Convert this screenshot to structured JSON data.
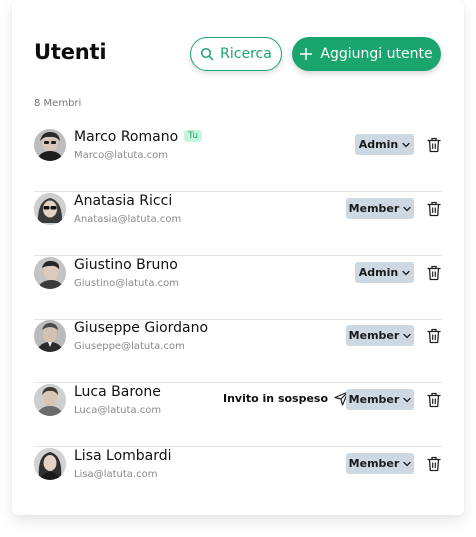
{
  "header": {
    "title": "Utenti",
    "search_label": "Ricerca",
    "add_label": "Aggiungi utente",
    "accent_color": "#1aa56f"
  },
  "members_count": "8 Membri",
  "users": [
    {
      "name": "Marco Romano",
      "email": "Marco@latuta.com",
      "role": "Admin",
      "badge": "Tu",
      "invite": ""
    },
    {
      "name": "Anatasia Ricci",
      "email": "Anatasia@latuta.com",
      "role": "Member",
      "badge": "",
      "invite": ""
    },
    {
      "name": "Giustino Bruno",
      "email": "Giustino@latuta.com",
      "role": "Admin",
      "badge": "",
      "invite": ""
    },
    {
      "name": "Giuseppe Giordano",
      "email": "Giuseppe@latuta.com",
      "role": "Member",
      "badge": "",
      "invite": ""
    },
    {
      "name": "Luca Barone",
      "email": "Luca@latuta.com",
      "role": "Member",
      "badge": "",
      "invite": "Invito in sospeso"
    },
    {
      "name": "Lisa Lombardi",
      "email": "Lisa@latuta.com",
      "role": "Member",
      "badge": "",
      "invite": ""
    }
  ],
  "icons": {
    "search": "search-icon",
    "add": "plus-icon",
    "dropdown": "chevron-down-icon",
    "delete": "trash-icon",
    "send": "send-icon"
  }
}
